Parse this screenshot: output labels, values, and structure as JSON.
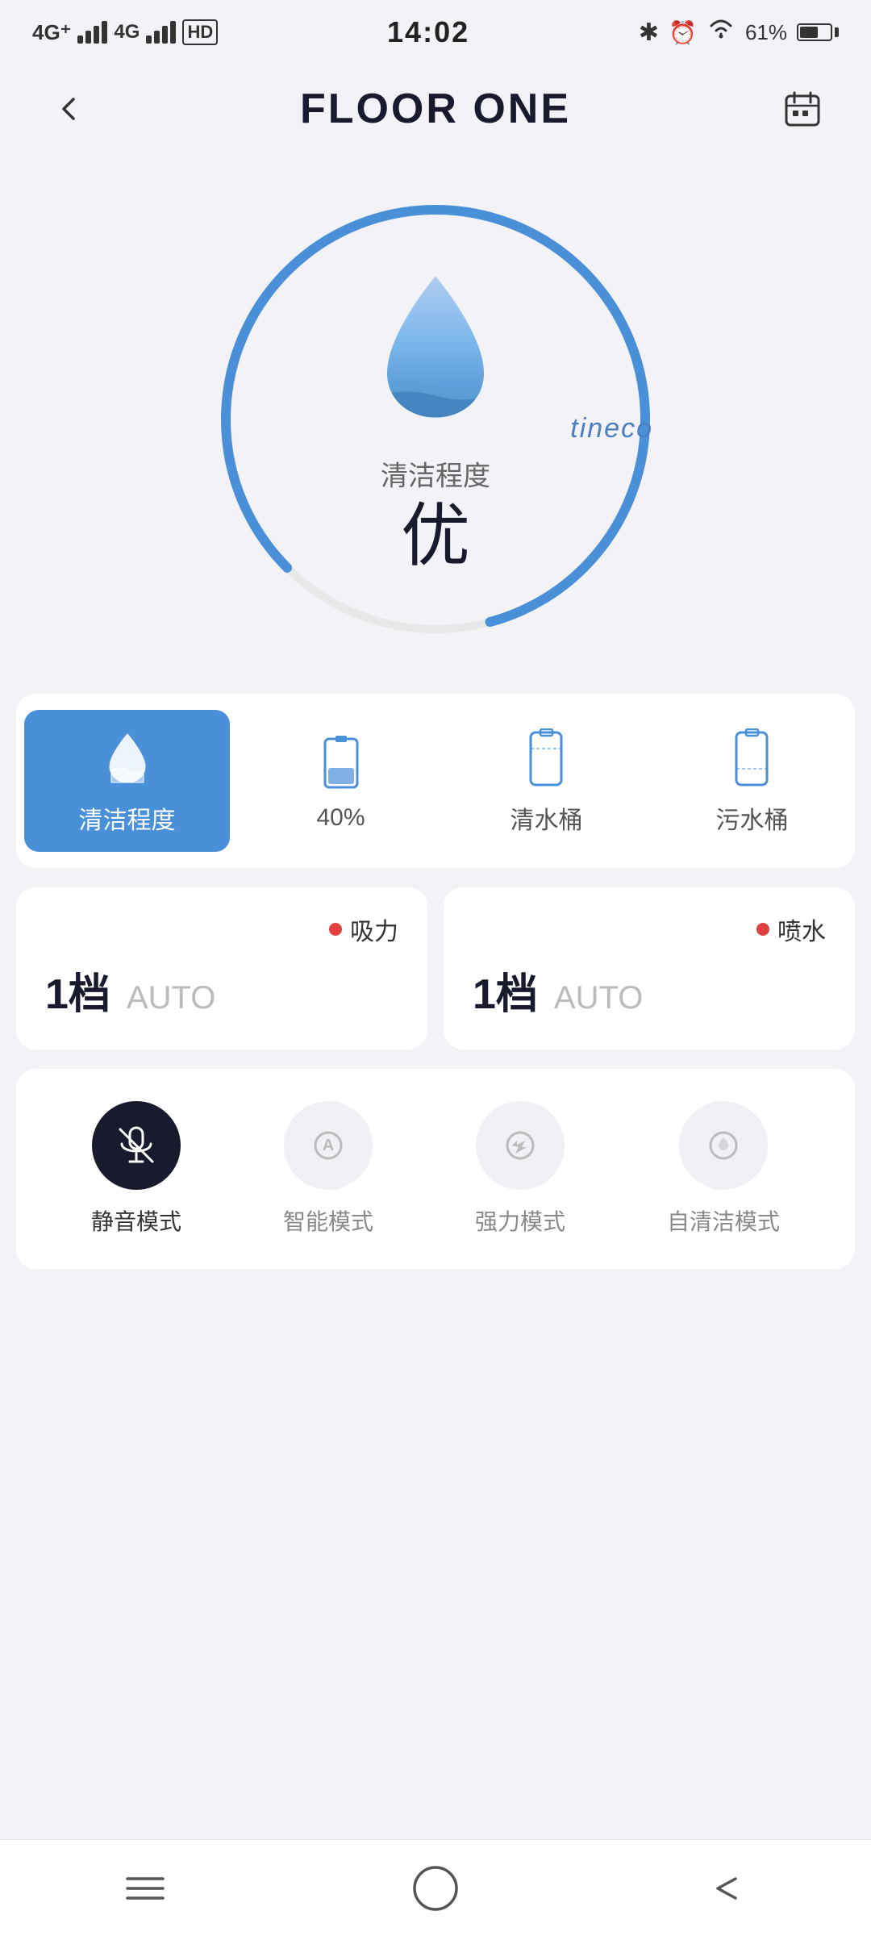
{
  "statusBar": {
    "time": "14:02",
    "battery": "61%",
    "network": "4G+"
  },
  "header": {
    "title": "FLOOR ONE",
    "backLabel": "←",
    "calendarLabel": "📅"
  },
  "circle": {
    "cleanLabel": "清洁程度",
    "cleanValue": "优",
    "brand": "tineco",
    "progressDegrees": 300
  },
  "tabs": [
    {
      "id": "clean",
      "label": "清洁程度",
      "value": "",
      "active": true
    },
    {
      "id": "battery",
      "label": "40%",
      "value": "40%",
      "active": false
    },
    {
      "id": "clean-tank",
      "label": "清水桶",
      "value": "",
      "active": false
    },
    {
      "id": "dirty-tank",
      "label": "污水桶",
      "value": "",
      "active": false
    }
  ],
  "controls": [
    {
      "dotLabel": "吸力",
      "gear": "1档",
      "auto": "AUTO"
    },
    {
      "dotLabel": "喷水",
      "gear": "1档",
      "auto": "AUTO"
    }
  ],
  "modes": [
    {
      "id": "silent",
      "label": "静音模式",
      "active": true
    },
    {
      "id": "smart",
      "label": "智能模式",
      "active": false
    },
    {
      "id": "power",
      "label": "强力模式",
      "active": false
    },
    {
      "id": "selfclean",
      "label": "自清洁模式",
      "active": false
    }
  ],
  "bottomNav": [
    {
      "id": "menu",
      "label": "menu"
    },
    {
      "id": "home",
      "label": "home"
    },
    {
      "id": "back",
      "label": "back"
    }
  ]
}
